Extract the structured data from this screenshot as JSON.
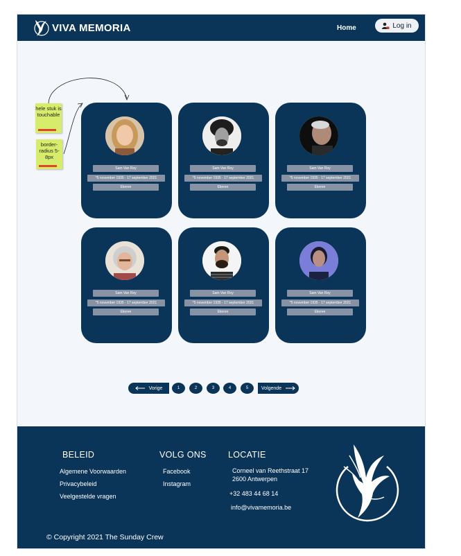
{
  "brand": {
    "name": "VIVA MEMORIA"
  },
  "nav": {
    "home": "Home",
    "login": "Log in"
  },
  "annotations": [
    {
      "text": "hele stuk is touchable"
    },
    {
      "text": "border-radius 5-8px"
    }
  ],
  "cards": [
    {
      "name": "Sam Van Roy",
      "dates": "*5 november 1935 - 17 september 2021",
      "place": "Ekeren",
      "photo": "woman-blonde"
    },
    {
      "name": "Sam Van Roy",
      "dates": "*5 november 1935 - 17 september 2021",
      "place": "Ekeren",
      "photo": "man-curly"
    },
    {
      "name": "Sam Van Roy",
      "dates": "*5 november 1935 - 17 september 2021",
      "place": "Ekeren",
      "photo": "old-man"
    },
    {
      "name": "Sam Van Roy",
      "dates": "*5 november 1935 - 17 september 2021",
      "place": "Ekeren",
      "photo": "old-woman"
    },
    {
      "name": "Sam Van Roy",
      "dates": "*5 november 1935 - 17 september 2021",
      "place": "Ekeren",
      "photo": "man-beard"
    },
    {
      "name": "Sam Van Roy",
      "dates": "*5 november 1935 - 17 september 2021",
      "place": "Ekeren",
      "photo": "woman-blue"
    }
  ],
  "pagination": {
    "prev": "Vorige",
    "next": "Volgende",
    "pages": [
      "1",
      "2",
      "3",
      "4",
      "5"
    ]
  },
  "footer": {
    "beleid": {
      "title": "BELEID",
      "links": [
        "Algemene Voorwaarden",
        "Privacybeleid",
        "Veelgestelde vragen"
      ]
    },
    "volg": {
      "title": "VOLG ONS",
      "links": [
        "Facebook",
        "Instagram"
      ]
    },
    "locatie": {
      "title": "LOCATIE",
      "address1": "Corneel van Reethstraat 17",
      "address2": "2600 Antwerpen",
      "phone": "+32 483 44 68 14",
      "email": "info@vivamemoria.be"
    },
    "copyright": "© Copyright 2021 The Sunday Crew"
  },
  "colors": {
    "primary": "#0b3558",
    "background": "#f3f6fa",
    "pill": "#8793a4",
    "sticky": "#d7ec6a"
  }
}
